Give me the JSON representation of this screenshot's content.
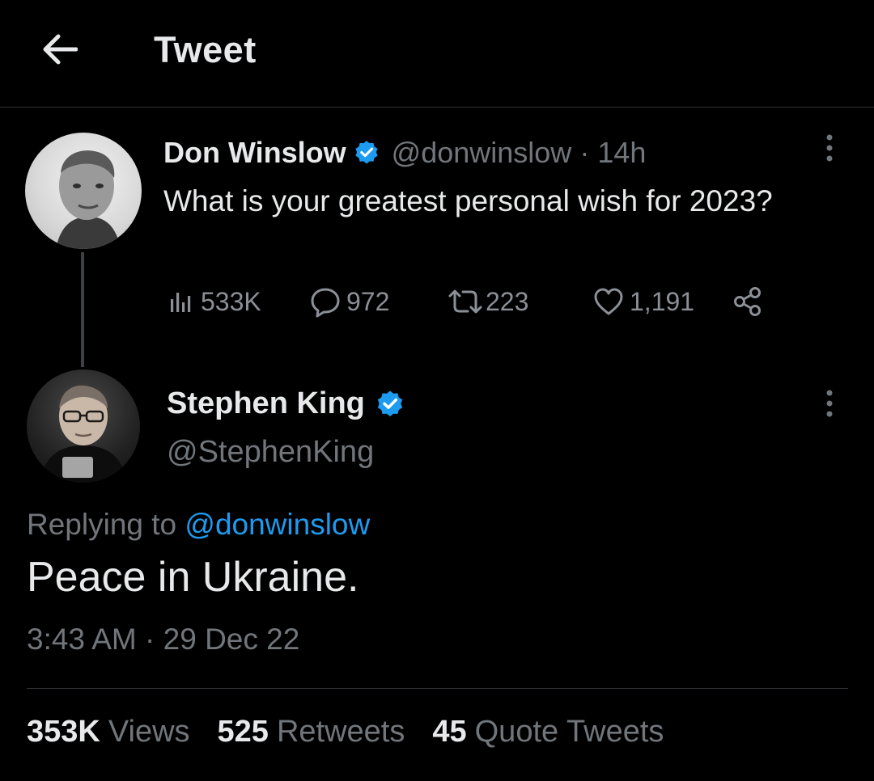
{
  "header": {
    "title": "Tweet",
    "back_icon": "arrow-left-icon"
  },
  "parent_tweet": {
    "display_name": "Don Winslow",
    "handle": "@donwinslow",
    "separator": "·",
    "time": "14h",
    "verified_icon": "verified-badge-icon",
    "text": "What is your greatest personal wish for 2023?",
    "actions": {
      "views": "533K",
      "replies": "972",
      "retweets": "223",
      "likes": "1,191"
    }
  },
  "main_tweet": {
    "display_name": "Stephen King",
    "handle": "@StephenKing",
    "verified_icon": "verified-badge-icon",
    "replying_prefix": "Replying to",
    "replying_to": "@donwinslow",
    "text": "Peace in Ukraine.",
    "time": "3:43 AM",
    "separator": "·",
    "date": "29 Dec 22"
  },
  "stats": {
    "views_count": "353K",
    "views_label": "Views",
    "retweets_count": "525",
    "retweets_label": "Retweets",
    "quotes_count": "45",
    "quotes_label": "Quote Tweets"
  },
  "colors": {
    "background": "#000000",
    "text": "#e7e9ea",
    "muted": "#71767b",
    "accent": "#1d9bf0",
    "border": "#2f3336"
  }
}
